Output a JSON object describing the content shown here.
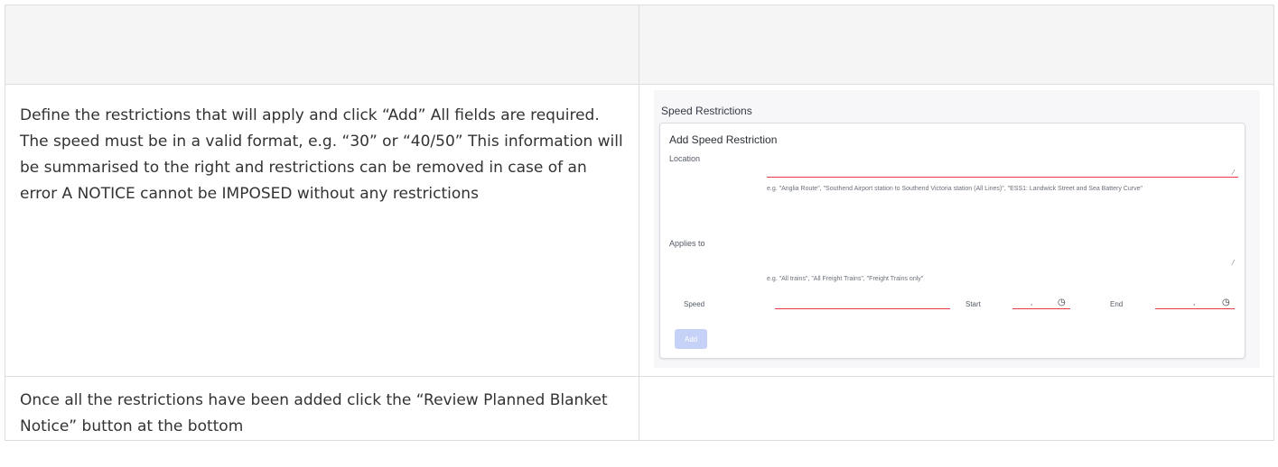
{
  "rows": [
    {
      "left_text": "Define the restrictions that will apply and click “Add” All fields are required. The speed must be in a valid format, e.g. “30” or “40/50” This information will be summarised to the right and restrictions can be removed in case of an error A NOTICE cannot be IMPOSED without any restrictions"
    },
    {
      "left_text": "Once all the restrictions have been added click the “Review Planned Blanket Notice” button at the bottom"
    }
  ],
  "screenshot": {
    "section_title": "Speed Restrictions",
    "card_title": "Add Speed Restriction",
    "location_label": "Location",
    "location_hint": "e.g. \"Anglia Route\", \"Southend Airport station to Southend Victoria station (All Lines)\", \"ESS1: Landwick Street and Sea Battery Curve\"",
    "applies_to_label": "Applies to",
    "applies_to_hint": "e.g. \"All trains\", \"All Freight Trains\", \"Freight Trains only\"",
    "speed_label": "Speed",
    "start_label": "Start",
    "end_label": "End",
    "add_button": "Add"
  },
  "colors": {
    "required_underline": "#e53945",
    "add_button_disabled": "#c6d1f7"
  }
}
